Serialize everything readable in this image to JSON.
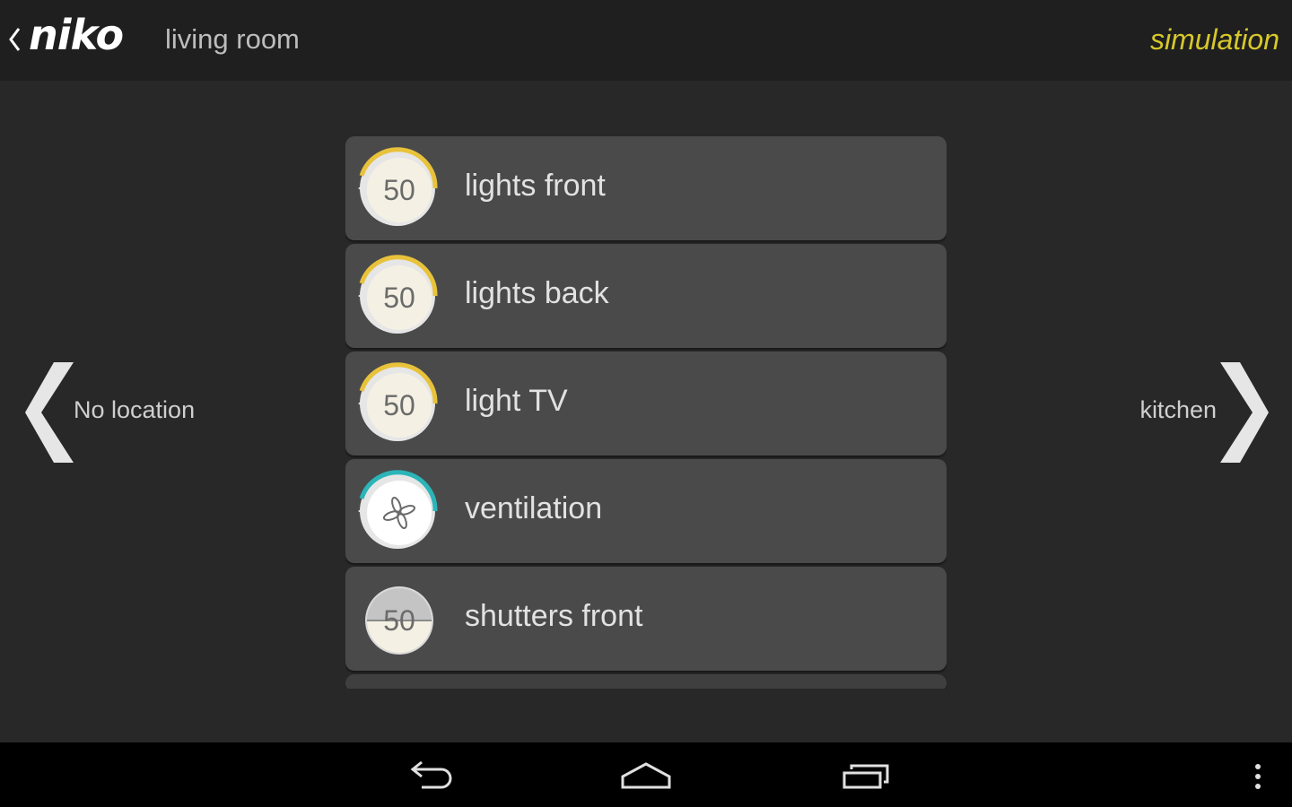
{
  "header": {
    "logo_text": "niko",
    "room_title": "living room",
    "mode_label": "simulation",
    "mode_color": "#d7c82a"
  },
  "nav": {
    "prev_location": "No location",
    "next_location": "kitchen"
  },
  "devices": [
    {
      "label": "lights front",
      "type": "dimmer",
      "value": "50",
      "level_percent": 50,
      "accent": "#e8c23a",
      "icon": "dimmer-dial-icon"
    },
    {
      "label": "lights back",
      "type": "dimmer",
      "value": "50",
      "level_percent": 50,
      "accent": "#e8c23a",
      "icon": "dimmer-dial-icon"
    },
    {
      "label": "light TV",
      "type": "dimmer",
      "value": "50",
      "level_percent": 50,
      "accent": "#e8c23a",
      "icon": "dimmer-dial-icon"
    },
    {
      "label": "ventilation",
      "type": "ventilation",
      "value": "",
      "accent": "#2bb5b8",
      "icon": "fan-icon"
    },
    {
      "label": "shutters front",
      "type": "shutter",
      "value": "50",
      "level_percent": 50,
      "accent": "#bdbdbd",
      "icon": "shutter-dial-icon"
    }
  ],
  "system_bar": {
    "icons": [
      "back-icon",
      "home-icon",
      "recent-apps-icon",
      "overflow-menu-icon"
    ]
  }
}
